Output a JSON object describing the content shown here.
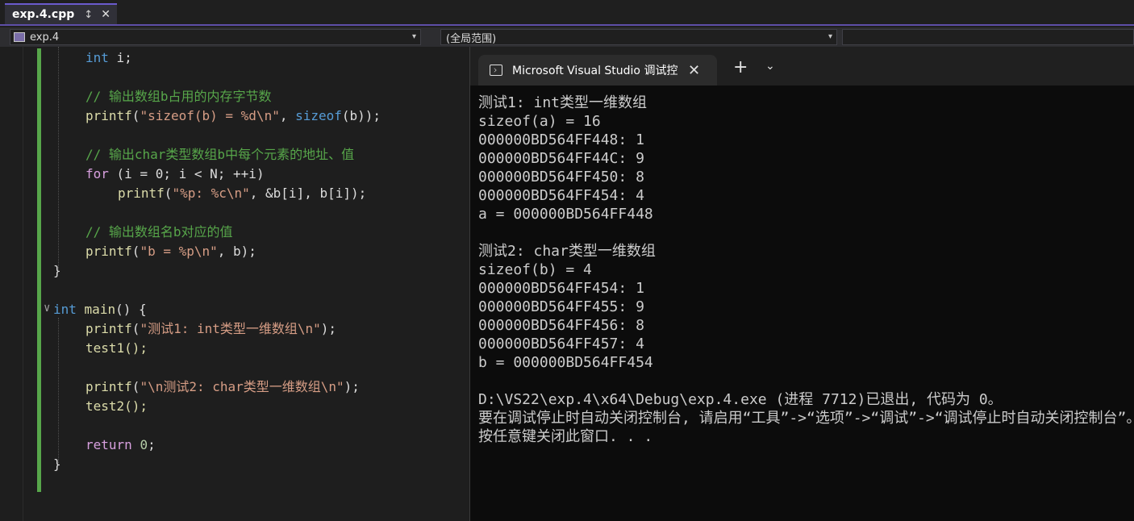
{
  "tabbar": {
    "file_tab": "exp.4.cpp",
    "pin_icon": "pin-icon",
    "close_icon": "close-icon"
  },
  "navbar": {
    "project": "exp.4",
    "scope": "(全局范围)"
  },
  "code": {
    "l01": "int i;",
    "l03": "// 输出数组b占用的内存字节数",
    "l04_fn": "printf",
    "l04_str": "\"sizeof(b) = %d\\n\"",
    "l04_kw": "sizeof",
    "l06": "// 输出char类型数组b中每个元素的地址、值",
    "l07_kw": "for",
    "l07_rest": "(i = 0; i < N; ++i)",
    "l08_fn": "printf",
    "l08_str": "\"%p: %c\\n\"",
    "l08_rest": ", &b[i], b[i]);",
    "l10": "// 输出数组名b对应的值",
    "l11_fn": "printf",
    "l11_str": "\"b = %p\\n\"",
    "l11_rest": ", b);",
    "l12": "}",
    "l14_kw": "int",
    "l14_fn": "main",
    "l14_rest": "() {",
    "l15_fn": "printf",
    "l15_str": "\"测试1: int类型一维数组\\n\"",
    "l15_rest": ");",
    "l16": "test1();",
    "l18_fn": "printf",
    "l18_str": "\"\\n测试2: char类型一维数组\\n\"",
    "l18_rest": ");",
    "l19": "test2();",
    "l21_kw": "return",
    "l21_num": "0",
    "l21_rest": ";",
    "l22": "}"
  },
  "console": {
    "tab_title": "Microsoft Visual Studio 调试控制台",
    "lines": [
      "测试1: int类型一维数组",
      "sizeof(a) = 16",
      "000000BD564FF448: 1",
      "000000BD564FF44C: 9",
      "000000BD564FF450: 8",
      "000000BD564FF454: 4",
      "a = 000000BD564FF448",
      "",
      "测试2: char类型一维数组",
      "sizeof(b) = 4",
      "000000BD564FF454: 1",
      "000000BD564FF455: 9",
      "000000BD564FF456: 8",
      "000000BD564FF457: 4",
      "b = 000000BD564FF454",
      "",
      "D:\\VS22\\exp.4\\x64\\Debug\\exp.4.exe (进程 7712)已退出, 代码为 0。",
      "要在调试停止时自动关闭控制台, 请启用“工具”->“选项”->“调试”->“调试停止时自动关闭控制台”。",
      "按任意键关闭此窗口. . ."
    ]
  }
}
